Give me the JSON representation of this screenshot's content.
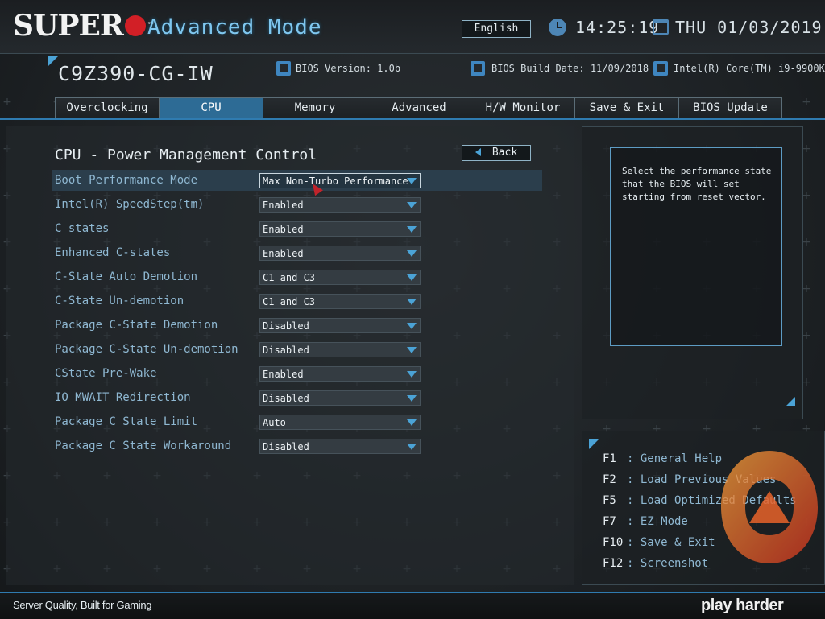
{
  "header": {
    "logo_text": "SUPER",
    "logo_tm": "™",
    "mode_title": "Advanced Mode",
    "language_button": "English",
    "time": "14:25:19",
    "date": "THU 01/03/2019"
  },
  "info": {
    "model": "C9Z390-CG-IW",
    "bios_version": "BIOS Version: 1.0b",
    "bios_build_date": "BIOS Build Date: 11/09/2018",
    "cpu": "Intel(R) Core(TM) i9-9900K"
  },
  "tabs": [
    {
      "label": "Overclocking",
      "active": false
    },
    {
      "label": "CPU",
      "active": true
    },
    {
      "label": "Memory",
      "active": false
    },
    {
      "label": "Advanced",
      "active": false
    },
    {
      "label": "H/W Monitor",
      "active": false
    },
    {
      "label": "Save & Exit",
      "active": false
    },
    {
      "label": "BIOS Update",
      "active": false
    }
  ],
  "section": {
    "title": "CPU - Power Management Control",
    "back_label": "Back"
  },
  "settings": [
    {
      "label": "Boot Performance Mode",
      "value": "Max Non-Turbo Performance",
      "selected": true
    },
    {
      "label": "Intel(R) SpeedStep(tm)",
      "value": "Enabled"
    },
    {
      "label": "C states",
      "value": "Enabled"
    },
    {
      "label": "Enhanced C-states",
      "value": "Enabled"
    },
    {
      "label": "C-State Auto Demotion",
      "value": "C1 and C3"
    },
    {
      "label": "C-State Un-demotion",
      "value": "C1 and C3"
    },
    {
      "label": "Package C-State Demotion",
      "value": "Disabled"
    },
    {
      "label": "Package C-State Un-demotion",
      "value": "Disabled"
    },
    {
      "label": "CState Pre-Wake",
      "value": "Enabled"
    },
    {
      "label": "IO MWAIT Redirection",
      "value": "Disabled"
    },
    {
      "label": "Package C State Limit",
      "value": "Auto"
    },
    {
      "label": "Package C State Workaround",
      "value": "Disabled"
    }
  ],
  "help": {
    "text": "Select the performance state\nthat the BIOS will set\nstarting from reset vector."
  },
  "keys": [
    {
      "key": "F1",
      "desc": ": General Help"
    },
    {
      "key": "F2",
      "desc": ": Load Previous Values"
    },
    {
      "key": "F5",
      "desc": ": Load Optimized Defaults"
    },
    {
      "key": "F7",
      "desc": ": EZ Mode"
    },
    {
      "key": "F10",
      "desc": ": Save & Exit"
    },
    {
      "key": "F12",
      "desc": ": Screenshot"
    }
  ],
  "footer": {
    "tagline": "Server Quality, Built for Gaming",
    "brand": "play harder"
  },
  "colors": {
    "accent": "#4ba3d6",
    "active_tab": "#2d6b95",
    "logo_red": "#d21f26"
  }
}
